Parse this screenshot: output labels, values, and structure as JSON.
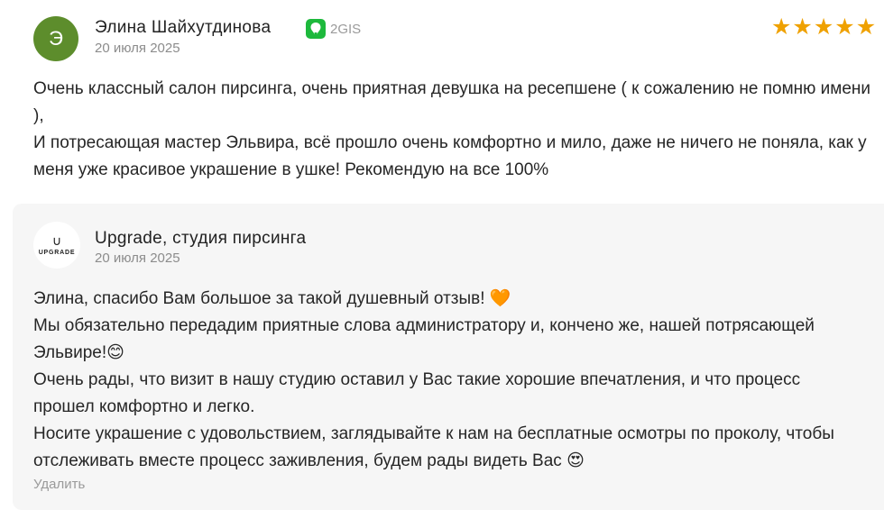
{
  "review": {
    "avatar_letter": "Э",
    "author_name": "Элина Шайхутдинова",
    "source": {
      "label": "2GIS",
      "icon": "2gis-icon",
      "color": "#1db93c"
    },
    "date": "20 июля 2025",
    "rating": 5,
    "stars": [
      "★",
      "★",
      "★",
      "★",
      "★"
    ],
    "text": [
      "Очень классный салон пирсинга, очень приятная девушка на ресепшене ( к сожалению не помню имени ),",
      "И потресающая мастер Эльвира, всё прошло очень комфортно и мило, даже не ничего не поняла, как у меня уже красивое украшение в ушке! Рекомендую на все 100%"
    ]
  },
  "reply": {
    "logo_mark": "∪",
    "logo_text": "UPGRADE",
    "author_name": "Upgrade, студия пирсинга",
    "date": "20 июля 2025",
    "text": [
      "Элина, спасибо Вам большое за такой душевный отзыв! 🧡",
      "Мы обязательно передадим приятные слова администратору и, кончено же, нашей потрясающей Эльвире!😊",
      "Очень рады, что визит в нашу студию оставил у Вас такие хорошие впечатления, и что процесс прошел комфортно и легко.",
      "Носите украшение с удовольствием, заглядывайте к нам на бесплатные осмотры по проколу, чтобы отслеживать вместе процесс заживления, будем рады видеть Вас 😍"
    ],
    "delete_label": "Удалить"
  },
  "colors": {
    "avatar_bg": "#5d8d2c",
    "star": "#efa100",
    "reply_bg": "#f6f6f6"
  }
}
